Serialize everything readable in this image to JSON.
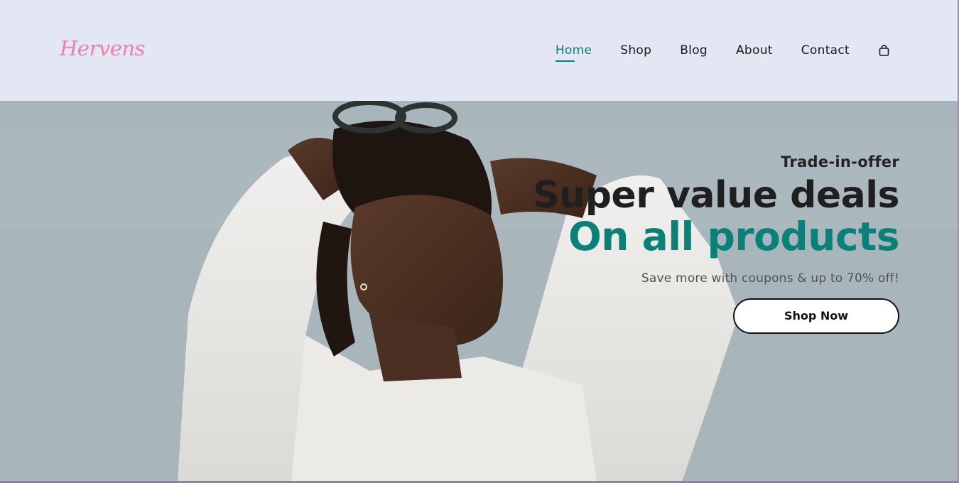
{
  "brand": {
    "logo_text": "Hervens",
    "logo_color": "#ef7fa9"
  },
  "nav": {
    "items": [
      {
        "label": "Home",
        "active": true
      },
      {
        "label": "Shop",
        "active": false
      },
      {
        "label": "Blog",
        "active": false
      },
      {
        "label": "About",
        "active": false
      },
      {
        "label": "Contact",
        "active": false
      }
    ],
    "cart_icon": "shopping-bag-icon"
  },
  "hero": {
    "eyebrow": "Trade-in-offer",
    "headline": "Super value deals",
    "headline_accent": "On all products",
    "subtext": "Save more with coupons & up to 70% off!",
    "cta_label": "Shop Now"
  },
  "colors": {
    "accent": "#088178",
    "header_bg": "#e3e6f3",
    "text_dark": "#1f1f1f"
  }
}
